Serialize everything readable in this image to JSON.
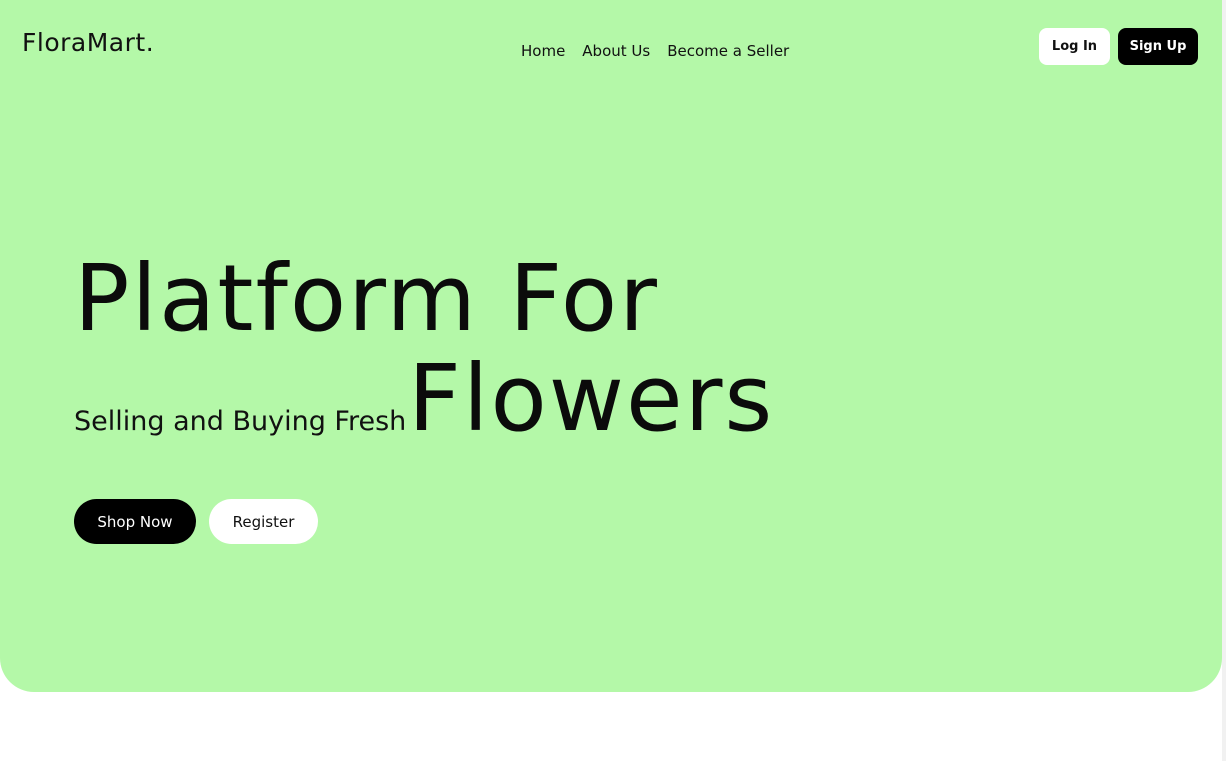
{
  "brand": {
    "logo": "FloraMart."
  },
  "nav": {
    "items": [
      "Home",
      "About Us",
      "Become a Seller"
    ]
  },
  "auth": {
    "login_label": "Log In",
    "signup_label": "Sign Up"
  },
  "hero": {
    "headline_line1": "Platform For",
    "subline": "Selling and Buying Fresh",
    "headline_line2": "Flowers",
    "shop_label": "Shop Now",
    "register_label": "Register"
  },
  "colors": {
    "hero_background": "#b4f8a8",
    "primary_button": "#000000",
    "secondary_button": "#ffffff"
  }
}
